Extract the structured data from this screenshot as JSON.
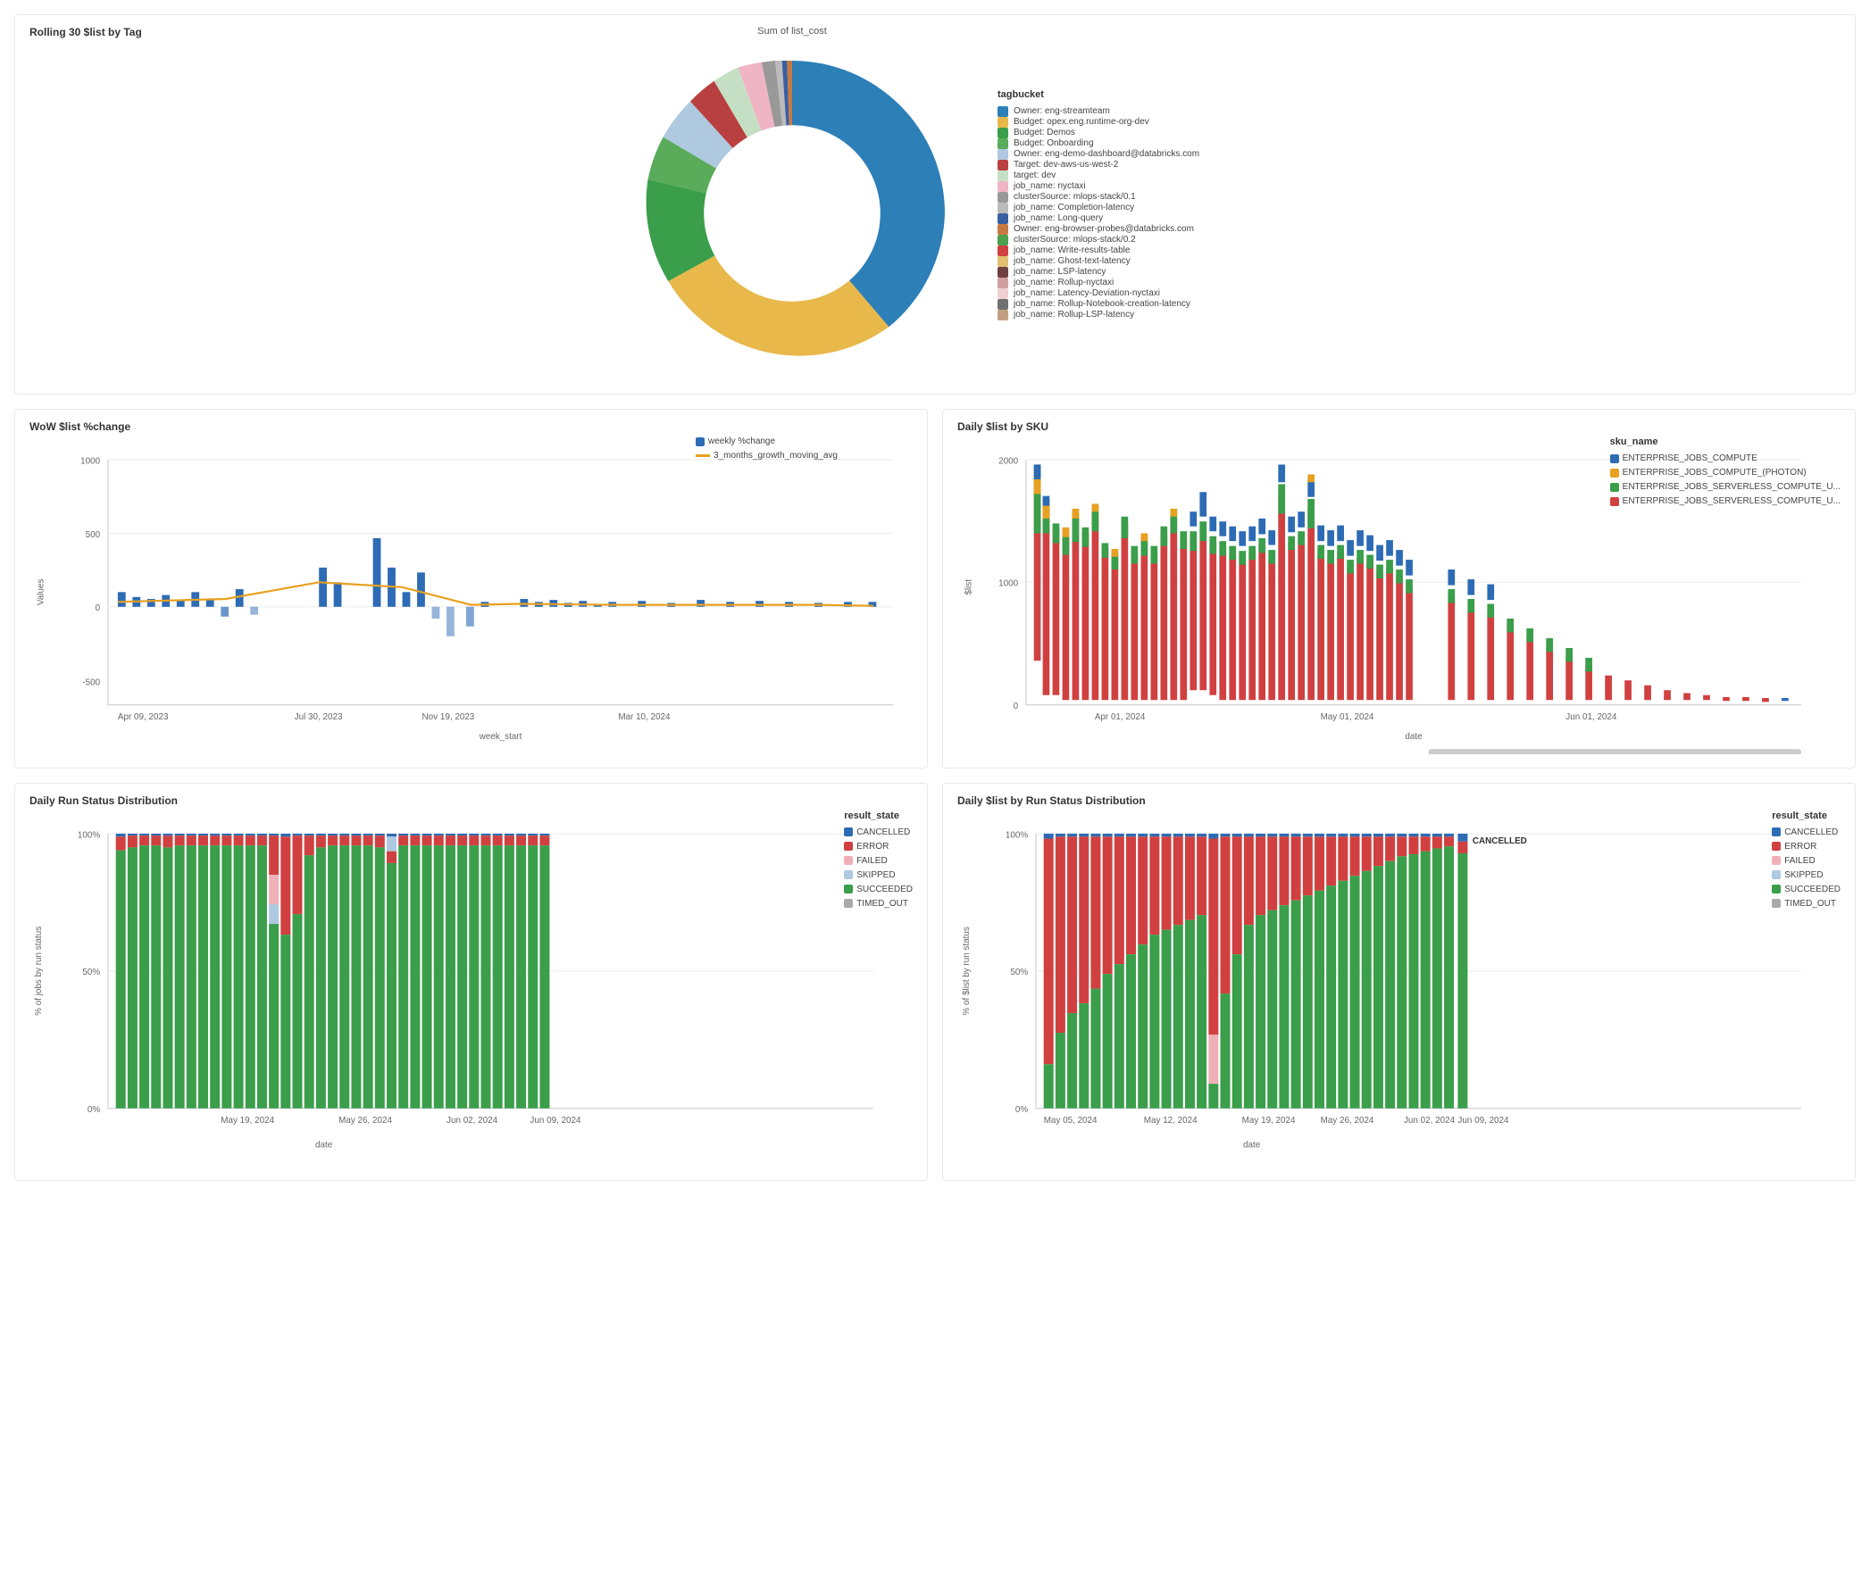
{
  "title": "Rolling 30 $list by Tag",
  "donut": {
    "subtitle": "Sum of list_cost",
    "legend_title": "tagbucket",
    "segments": [
      {
        "label": "Owner: eng-streamteam",
        "color": "#2d7fb8",
        "pct": 42
      },
      {
        "label": "Budget: opex.eng.runtime-org-dev",
        "color": "#e8b84b",
        "pct": 28
      },
      {
        "label": "Budget: Demos",
        "color": "#3a9e4a",
        "pct": 7
      },
      {
        "label": "Budget: Onboarding",
        "color": "#5aab5a",
        "pct": 3
      },
      {
        "label": "Owner: eng-demo-dashboard@databricks.com",
        "color": "#aec9e0",
        "pct": 3
      },
      {
        "label": "Target: dev-aws-us-west-2",
        "color": "#b94040",
        "pct": 2
      },
      {
        "label": "target: dev",
        "color": "#c5dfc5",
        "pct": 2
      },
      {
        "label": "job_name: nyctaxi",
        "color": "#f0b5c5",
        "pct": 2
      },
      {
        "label": "clusterSource: mlops-stack/0.1",
        "color": "#999",
        "pct": 2
      },
      {
        "label": "job_name: Completion-latency",
        "color": "#bbb",
        "pct": 1
      },
      {
        "label": "job_name: Long-query",
        "color": "#3a5fa0",
        "pct": 1
      },
      {
        "label": "Owner: eng-browser-probes@databricks.com",
        "color": "#c87941",
        "pct": 1
      },
      {
        "label": "clusterSource: mlops-stack/0.2",
        "color": "#4da04d",
        "pct": 1
      },
      {
        "label": "job_name: Write-results-table",
        "color": "#d04040",
        "pct": 1
      },
      {
        "label": "job_name: Ghost-text-latency",
        "color": "#e0c070",
        "pct": 1
      },
      {
        "label": "job_name: LSP-latency",
        "color": "#704040",
        "pct": 1
      },
      {
        "label": "job_name: Rollup-nyctaxi",
        "color": "#d0a0a0",
        "pct": 1
      },
      {
        "label": "job_name: Latency-Deviation-nyctaxi",
        "color": "#f0d0d0",
        "pct": 1
      },
      {
        "label": "job_name: Rollup-Notebook-creation-latency",
        "color": "#707070",
        "pct": 1
      },
      {
        "label": "job_name: Rollup-LSP-latency",
        "color": "#c0a080",
        "pct": 1
      }
    ]
  },
  "wow": {
    "title": "WoW $list %change",
    "x_label": "week_start",
    "y_label": "Values",
    "x_ticks": [
      "Apr 09, 2023",
      "Jul 30, 2023",
      "Nov 19, 2023",
      "Mar 10, 2024"
    ],
    "y_ticks": [
      "-500",
      "0",
      "500",
      "1000"
    ],
    "legend": [
      {
        "label": "weekly %change",
        "color": "#2d6bb5",
        "type": "bar"
      },
      {
        "label": "3_months_growth_moving_avg",
        "color": "#e8a020",
        "type": "line"
      }
    ]
  },
  "daily_sku": {
    "title": "Daily $list by SKU",
    "x_label": "date",
    "y_label": "$list",
    "x_ticks": [
      "Apr 01, 2024",
      "May 01, 2024",
      "Jun 01, 2024"
    ],
    "y_ticks": [
      "0",
      "1000",
      "2000"
    ],
    "legend_title": "sku_name",
    "legend": [
      {
        "label": "ENTERPRISE_JOBS_COMPUTE",
        "color": "#2d6bb5"
      },
      {
        "label": "ENTERPRISE_JOBS_COMPUTE_(PHOTON)",
        "color": "#e8a020"
      },
      {
        "label": "ENTERPRISE_JOBS_SERVERLESS_COMPUTE_U...",
        "color": "#3a9e4a"
      },
      {
        "label": "ENTERPRISE_JOBS_SERVERLESS_COMPUTE_U...",
        "color": "#d04040"
      }
    ]
  },
  "daily_status": {
    "title": "Daily Run Status Distribution",
    "x_label": "date",
    "y_label": "% of jobs by run status",
    "x_ticks": [
      "May 19, 2024",
      "May 26, 2024",
      "Jun 02, 2024",
      "Jun 09, 2024"
    ],
    "y_ticks": [
      "0%",
      "50%",
      "100%"
    ],
    "legend_title": "result_state",
    "legend": [
      {
        "label": "CANCELLED",
        "color": "#2d6bb5"
      },
      {
        "label": "ERROR",
        "color": "#d04040"
      },
      {
        "label": "FAILED",
        "color": "#f0b0b8"
      },
      {
        "label": "SKIPPED",
        "color": "#aec9e0"
      },
      {
        "label": "SUCCEEDED",
        "color": "#3a9e4a"
      },
      {
        "label": "TIMED_OUT",
        "color": "#aaa"
      }
    ]
  },
  "daily_list_status": {
    "title": "Daily $list by Run Status Distribution",
    "x_label": "date",
    "y_label": "% of $list by run status",
    "x_ticks": [
      "May 05, 2024",
      "May 12, 2024",
      "May 19, 2024",
      "May 26, 2024",
      "Jun 02, 2024",
      "Jun 09, 2024"
    ],
    "y_ticks": [
      "0%",
      "50%",
      "100%"
    ],
    "legend_title": "result_state",
    "legend": [
      {
        "label": "CANCELLED",
        "color": "#2d6bb5"
      },
      {
        "label": "ERROR",
        "color": "#d04040"
      },
      {
        "label": "FAILED",
        "color": "#f0b0b8"
      },
      {
        "label": "SKIPPED",
        "color": "#aec9e0"
      },
      {
        "label": "SUCCEEDED",
        "color": "#3a9e4a"
      },
      {
        "label": "TIMED_OUT",
        "color": "#aaa"
      }
    ]
  }
}
